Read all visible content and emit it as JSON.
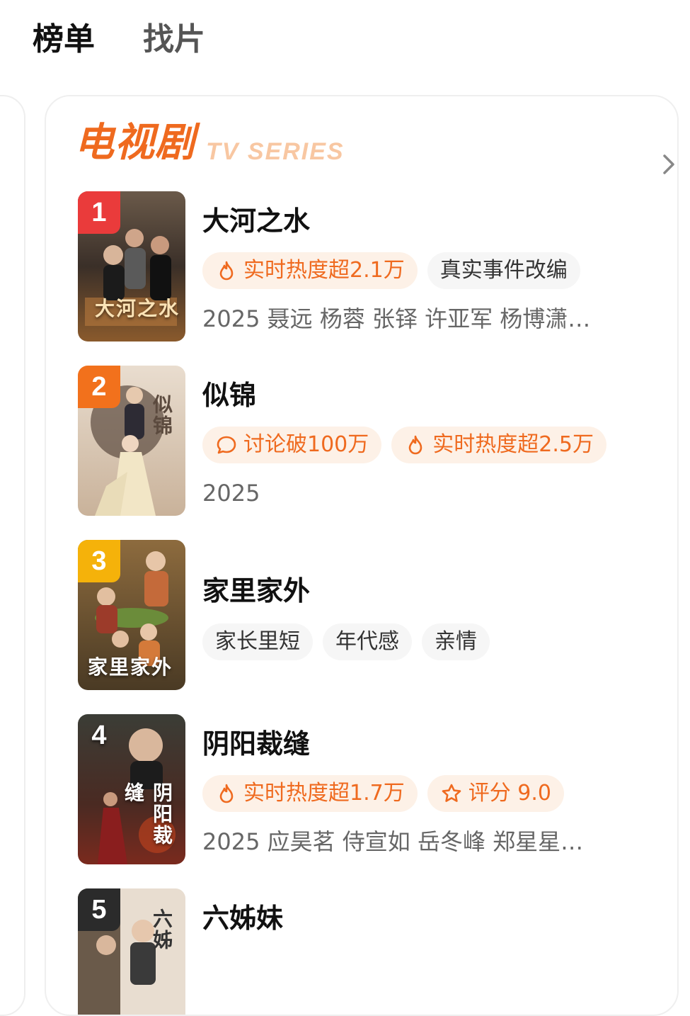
{
  "tabs": [
    {
      "label": "榜单"
    },
    {
      "label": "找片"
    }
  ],
  "category": {
    "title": "电视剧",
    "subtitle": "TV SERIES"
  },
  "accent": "#ef6a1f",
  "rank_colors": [
    "#ea3b3b",
    "#f2711c",
    "#f5b20a",
    "#2b2b2b",
    "#2b2b2b"
  ],
  "items": [
    {
      "rank": "1",
      "title": "大河之水",
      "poster_text": "大河之水",
      "tags": [
        {
          "icon": "flame-icon",
          "label": "实时热度超2.1万",
          "style": "hot"
        },
        {
          "label": "真实事件改编",
          "style": "plain"
        }
      ],
      "meta": "2025 聂远 杨蓉 张铎 许亚军 杨博潇…"
    },
    {
      "rank": "2",
      "title": "似锦",
      "poster_text": "似锦",
      "tags": [
        {
          "icon": "comment-icon",
          "label": "讨论破100万",
          "style": "hot"
        },
        {
          "icon": "flame-icon",
          "label": "实时热度超2.5万",
          "style": "hot"
        }
      ],
      "meta": "2025"
    },
    {
      "rank": "3",
      "title": "家里家外",
      "poster_text": "家里家外",
      "tags": [
        {
          "label": "家长里短",
          "style": "plain"
        },
        {
          "label": "年代感",
          "style": "plain"
        },
        {
          "label": "亲情",
          "style": "plain"
        }
      ],
      "meta": ""
    },
    {
      "rank": "4",
      "title": "阴阳裁缝",
      "poster_text": "阴阳裁缝",
      "tags": [
        {
          "icon": "flame-icon",
          "label": "实时热度超1.7万",
          "style": "hot"
        },
        {
          "icon": "star-icon",
          "label": "评分 9.0",
          "style": "hot"
        }
      ],
      "meta": "2025 应昊茗 侍宣如 岳冬峰 郑星星…"
    },
    {
      "rank": "5",
      "title": "六姊妹",
      "poster_text": "六姊",
      "tags": [],
      "meta": ""
    }
  ]
}
